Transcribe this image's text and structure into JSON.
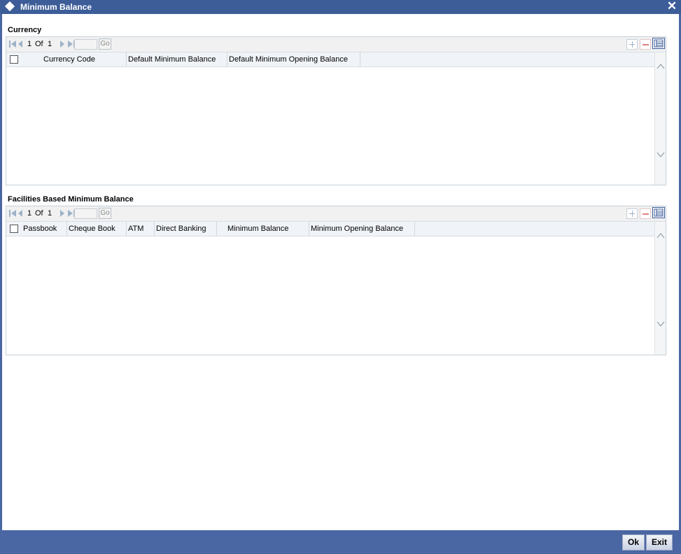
{
  "window": {
    "title": "Minimum Balance",
    "close_glyph": "✕"
  },
  "currency": {
    "title": "Currency",
    "pager": {
      "current": "1",
      "of_label": "Of",
      "total": "1",
      "go_label": "Go"
    },
    "columns": [
      "Currency Code",
      "Default Minimum Balance",
      "Default Minimum Opening Balance"
    ]
  },
  "facilities": {
    "title": "Facilities Based Minimum Balance",
    "pager": {
      "current": "1",
      "of_label": "Of",
      "total": "1",
      "go_label": "Go"
    },
    "columns": [
      "Passbook",
      "Cheque Book",
      "ATM",
      "Direct Banking",
      "Minimum Balance",
      "Minimum Opening Balance"
    ]
  },
  "footer": {
    "ok_label": "Ok",
    "exit_label": "Exit"
  },
  "colors": {
    "title_bar": "#3d5d99",
    "frame": "#4a66a3",
    "body": "#ffffff"
  }
}
